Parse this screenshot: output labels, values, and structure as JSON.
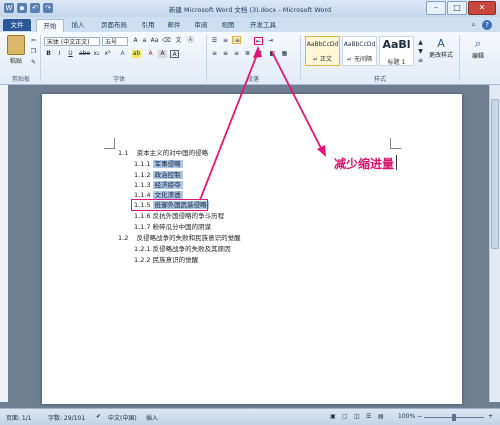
{
  "window": {
    "title": "新建 Microsoft Word 文档 (3).docx - Microsoft Word"
  },
  "tabs": [
    {
      "label": "文件"
    },
    {
      "label": "开始"
    },
    {
      "label": "插入"
    },
    {
      "label": "页面布局"
    },
    {
      "label": "引用"
    },
    {
      "label": "邮件"
    },
    {
      "label": "审阅"
    },
    {
      "label": "视图"
    },
    {
      "label": "开发工具"
    }
  ],
  "ribbon": {
    "clipboard": {
      "paste_label": "粘贴",
      "group_label": "剪贴板"
    },
    "font": {
      "name": "宋体 (中文正文)",
      "size": "五号",
      "group_label": "字体"
    },
    "paragraph": {
      "group_label": "段落"
    },
    "styles": {
      "items": [
        {
          "sample": "AaBbCcDd",
          "name": "↵ 正文"
        },
        {
          "sample": "AaBbCcDd",
          "name": "↵ 无间隔"
        },
        {
          "sample": "AaBl",
          "name": "标题 1"
        }
      ],
      "change_label": "更改样式",
      "group_label": "样式"
    },
    "editing": {
      "label": "编辑"
    }
  },
  "document": {
    "lines": [
      {
        "num": "1.1",
        "text": "资本主义的对中国的侵略"
      },
      {
        "num": "1.1.1",
        "text": "军事侵略"
      },
      {
        "num": "1.1.2",
        "text": "政治控制"
      },
      {
        "num": "1.1.3",
        "text": "经济掠夺"
      },
      {
        "num": "1.1.4",
        "text": "文化渗透"
      },
      {
        "num": "1.1.5",
        "text": "抵御外国武装侵略"
      },
      {
        "num": "1.1.6",
        "text": "反抗外国侵略的争斗历程"
      },
      {
        "num": "1.1.7",
        "text": "粉碎瓜分中国的阴谋"
      },
      {
        "num": "1.2",
        "text": "反侵略战争的失败和民族意识的觉醒"
      },
      {
        "num": "1.2.1",
        "text": "反侵略战争的失败及其原因"
      },
      {
        "num": "1.2.2",
        "text": "民族意识的觉醒"
      }
    ]
  },
  "annotation": {
    "text": "减少缩进量",
    "color": "#d8166f"
  },
  "status": {
    "page": "页面: 1/1",
    "words": "字数: 29/101",
    "language": "中文(中国)",
    "mode": "插入",
    "zoom": "100%",
    "zoom_fraction": 0.5
  }
}
